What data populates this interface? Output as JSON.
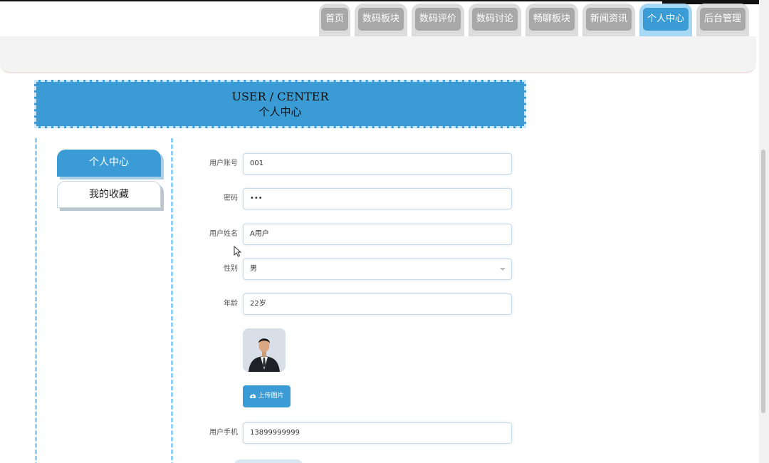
{
  "nav": {
    "tabs": [
      {
        "label": "首页",
        "active": false
      },
      {
        "label": "数码板块",
        "active": false
      },
      {
        "label": "数码评价",
        "active": false
      },
      {
        "label": "数码讨论",
        "active": false
      },
      {
        "label": "畅聊板块",
        "active": false
      },
      {
        "label": "新闻资讯",
        "active": false
      },
      {
        "label": "个人中心",
        "active": true
      },
      {
        "label": "后台管理",
        "active": false
      }
    ]
  },
  "heading": {
    "title_en": "USER / CENTER",
    "title_cn": "个人中心"
  },
  "sidebar": {
    "items": [
      {
        "label": "个人中心",
        "active": true
      },
      {
        "label": "我的收藏",
        "active": false
      }
    ]
  },
  "form": {
    "account_label": "用户账号",
    "account_value": "001",
    "password_label": "密码",
    "password_value": "•••",
    "name_label": "用户姓名",
    "name_value": "A用户",
    "gender_label": "性别",
    "gender_value": "男",
    "age_label": "年龄",
    "age_value": "22岁",
    "upload_label": "上传图片",
    "phone_label": "用户手机",
    "phone_value": "13899999999"
  },
  "colors": {
    "accent": "#3a9bd5",
    "tab_inactive": "#a8a8a8",
    "tab_frame": "#dcdcdc",
    "dashed_border": "#8fd0f4"
  },
  "icons": {
    "upload": "cloud-upload-icon",
    "cursor": "mouse-pointer-icon",
    "select": "chevron-down-icon"
  }
}
